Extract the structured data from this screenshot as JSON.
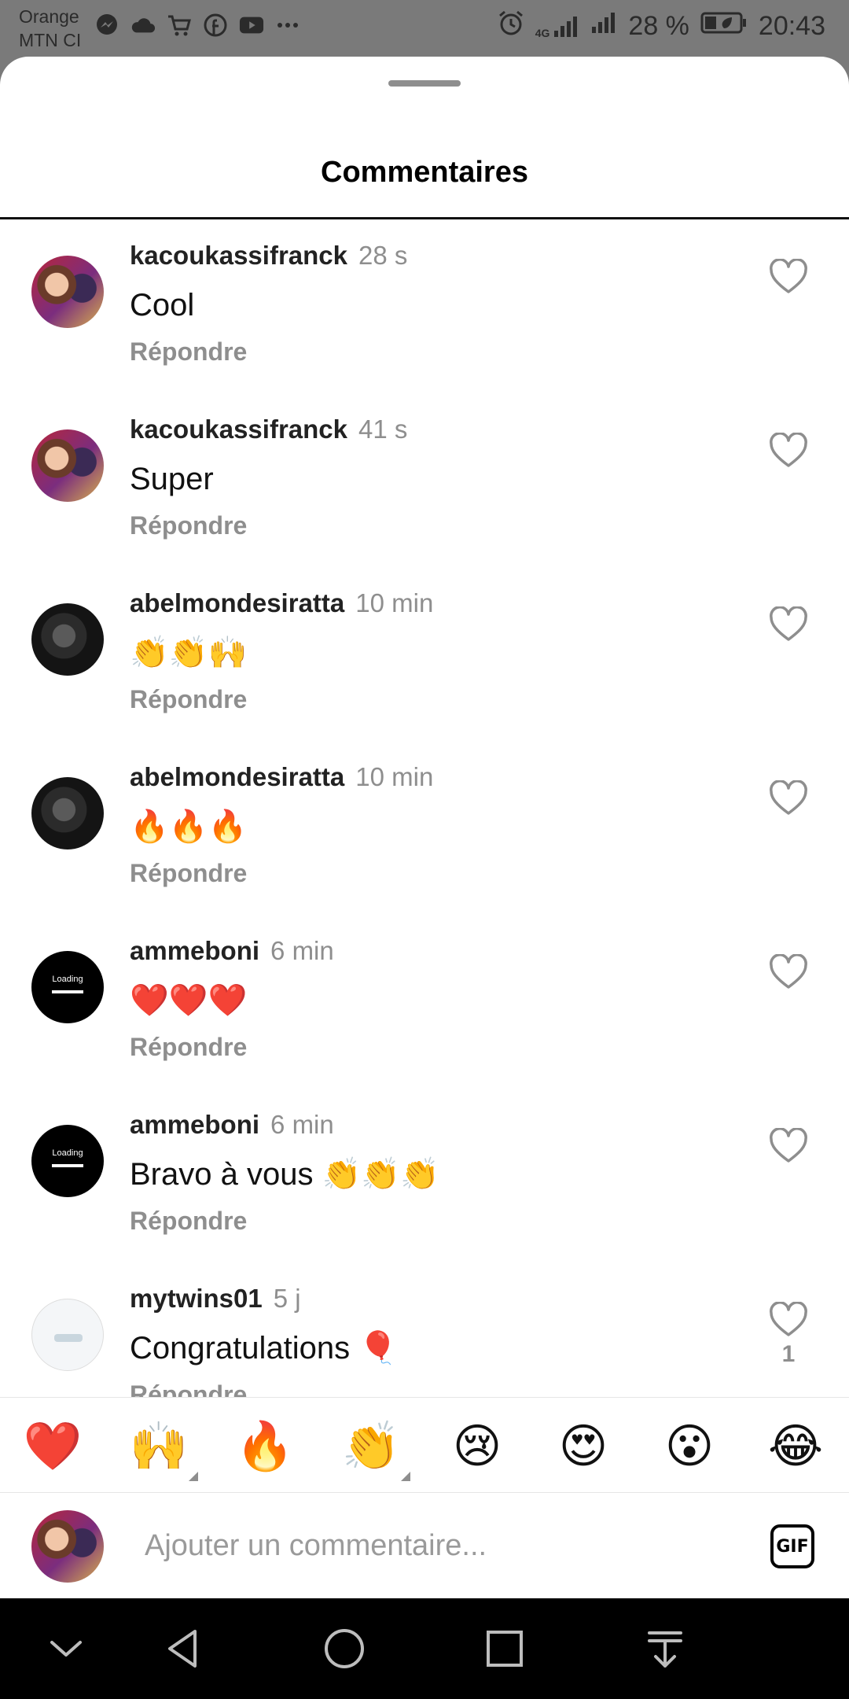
{
  "status_bar": {
    "carrier_line1": "Orange",
    "carrier_line2": "MTN CI",
    "signal_label": "4G",
    "battery": "28 %",
    "time": "20:43",
    "left_icons": [
      "messenger-icon",
      "cloud-icon",
      "cart-icon",
      "facebook-icon",
      "youtube-icon",
      "more-icon"
    ]
  },
  "sheet": {
    "title": "Commentaires"
  },
  "comments": [
    {
      "user": "kacoukassifranck",
      "time": "28 s",
      "text": "Cool",
      "reply": "Répondre",
      "avatar": "franck"
    },
    {
      "user": "kacoukassifranck",
      "time": "41 s",
      "text": "Super",
      "reply": "Répondre",
      "avatar": "franck"
    },
    {
      "user": "abelmondesiratta",
      "time": "10 min",
      "text": "👏👏🙌",
      "reply": "Répondre",
      "avatar": "abel"
    },
    {
      "user": "abelmondesiratta",
      "time": "10 min",
      "text": "🔥🔥🔥",
      "reply": "Répondre",
      "avatar": "abel"
    },
    {
      "user": "ammeboni",
      "time": "6 min",
      "text": "❤️❤️❤️",
      "reply": "Répondre",
      "avatar": "loading"
    },
    {
      "user": "ammeboni",
      "time": "6 min",
      "text": "Bravo à vous 👏👏👏",
      "reply": "Répondre",
      "avatar": "loading"
    },
    {
      "user": "mytwins01",
      "time": "5 j",
      "text": "Congratulations 🎈",
      "reply": "Répondre",
      "avatar": "twins",
      "likes": "1"
    }
  ],
  "avatar_loading_label": "Loading",
  "reactions": [
    "❤️",
    "🙌",
    "🔥",
    "👏",
    "😢",
    "😍",
    "😮",
    "😂"
  ],
  "composer": {
    "placeholder": "Ajouter un commentaire...",
    "gif_label": "GIF"
  },
  "colors": {
    "muted_text": "#8e8e8e",
    "status_bar_bg": "#7a7a7a",
    "nav_bar_bg": "#000000"
  }
}
